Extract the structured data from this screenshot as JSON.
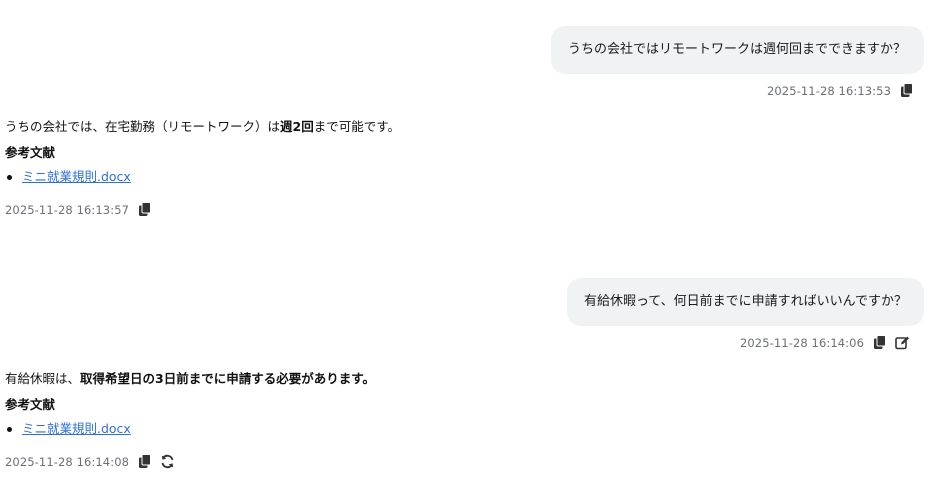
{
  "messages": [
    {
      "role": "user",
      "text": "うちの会社ではリモートワークは週何回までできますか？",
      "timestamp": "2025-11-28 16:13:53",
      "actions": [
        "copy-icon"
      ]
    },
    {
      "role": "assistant",
      "answer": {
        "pre": "うちの会社では、在宅勤務（リモートワーク）は",
        "bold1": "週2回",
        "mid": "まで",
        "bold2": "",
        "post": "可能です。"
      },
      "refs_title": "参考文献",
      "refs": [
        "ミニ就業規則.docx"
      ],
      "timestamp": "2025-11-28 16:13:57",
      "actions": [
        "copy-icon"
      ]
    },
    {
      "role": "user",
      "text": "有給休暇って、何日前までに申請すればいいんですか？",
      "timestamp": "2025-11-28 16:14:06",
      "actions": [
        "copy-icon",
        "edit-icon"
      ]
    },
    {
      "role": "assistant",
      "answer": {
        "pre": "有給休暇は、",
        "bold1": "取得希望日の3日前までに申請する必要があります。",
        "mid": "",
        "bold2": "",
        "post": ""
      },
      "refs_title": "参考文献",
      "refs": [
        "ミニ就業規則.docx"
      ],
      "timestamp": "2025-11-28 16:14:08",
      "actions": [
        "copy-icon",
        "regenerate-icon"
      ]
    }
  ],
  "colors": {
    "bubble_bg": "#f1f2f4",
    "link": "#2f6fd6",
    "meta_text": "#6b6f76",
    "icon": "#333333"
  }
}
